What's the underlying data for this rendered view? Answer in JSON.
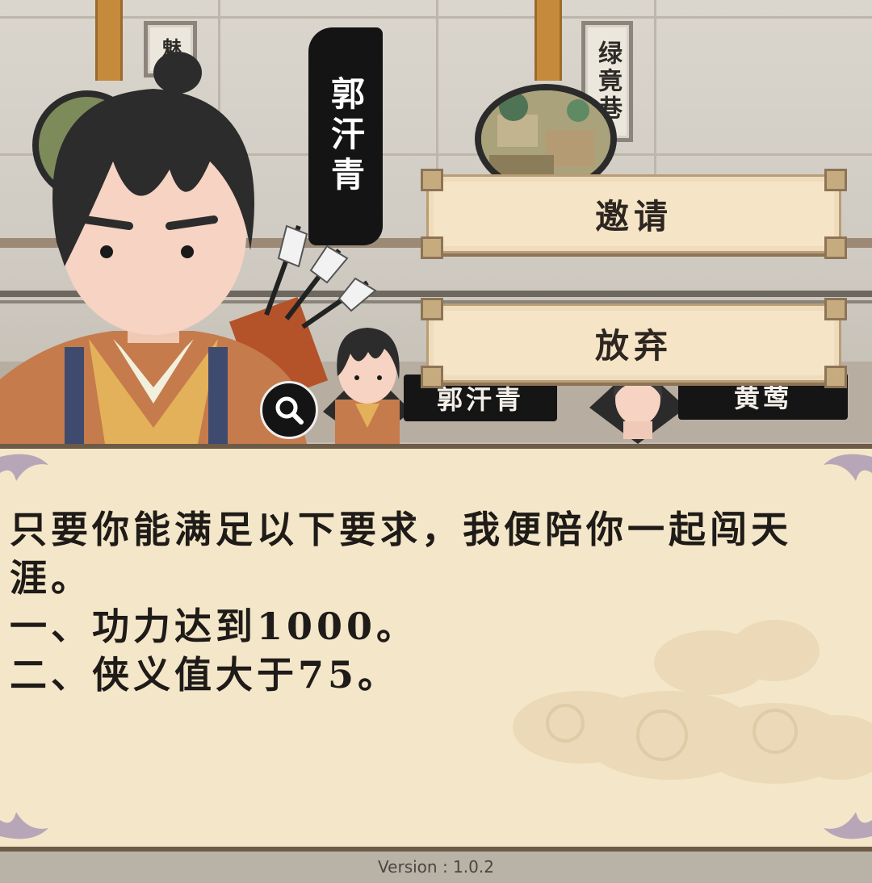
{
  "scene": {
    "location_sign_left": "魅",
    "location_sign_right": "绿竟巷",
    "speaker_banner": "郭汗青"
  },
  "menu": {
    "invite_label": "邀请",
    "abandon_label": "放弃"
  },
  "party": {
    "members": [
      {
        "name": "郭汗青"
      },
      {
        "name": "黄莺"
      }
    ]
  },
  "dialog": {
    "lines": [
      "只要你能满足以下要求，我便陪你一起闯天涯。",
      "一、功力达到1000。",
      "二、侠义值大于75。"
    ]
  },
  "footer": {
    "version": "Version : 1.0.2"
  },
  "icons": {
    "search": "magnifier-icon"
  }
}
